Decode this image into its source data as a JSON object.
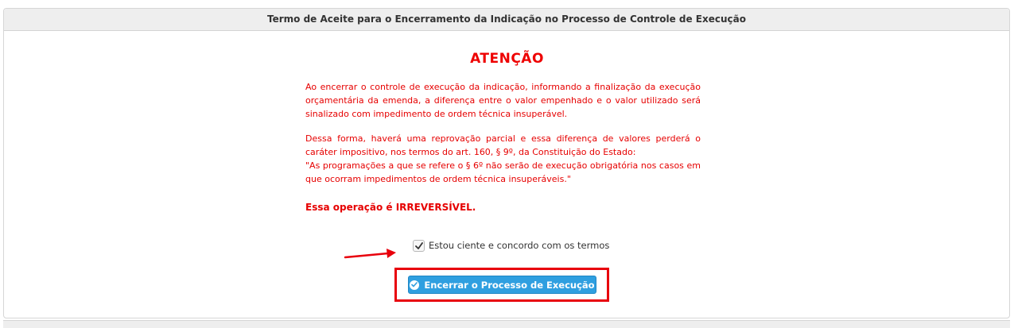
{
  "panel": {
    "title": "Termo de Aceite para o Encerramento da Indicação no Processo de Controle de Execução"
  },
  "warning": {
    "title": "ATENÇÃO",
    "paragraph1": "Ao encerrar o controle de execução da indicação, informando a finalização da execução orçamentária da emenda, a diferença entre o valor empenhado e o valor utilizado será sinalizado com impedimento de ordem técnica insuperável.",
    "paragraph2_line1": "Dessa forma, haverá uma reprovação parcial e essa diferença de valores perderá o caráter impositivo, nos termos do art. 160, § 9º, da Constituição do Estado:",
    "paragraph2_quote": "\"As programações a que se refere o § 6º não serão de execução obrigatória nos casos em que ocorram impedimentos de ordem técnica insuperáveis.\"",
    "irreversible": "Essa operação é IRREVERSÍVEL."
  },
  "agreement": {
    "label": "Estou ciente e concordo com os termos",
    "checked": true
  },
  "actions": {
    "close_button_label": "Encerrar o Processo de Execução"
  },
  "colors": {
    "warning_red": "#e60000",
    "primary_blue": "#2f9fe0",
    "annotation_red": "#e8000c"
  },
  "icons": {
    "checkbox": "check-icon",
    "button": "check-circle-icon",
    "annotation": "arrow-right-icon"
  }
}
